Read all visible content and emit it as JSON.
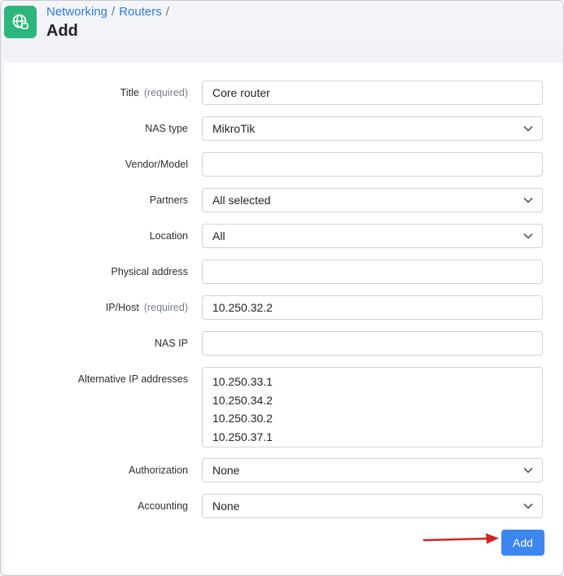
{
  "breadcrumb": {
    "items": [
      "Networking",
      "Routers"
    ],
    "separator": "/"
  },
  "page": {
    "title": "Add"
  },
  "icons": {
    "app": "globe-router-icon",
    "select_caret": "chevron-down-icon"
  },
  "colors": {
    "app_icon_bg": "#2db67c",
    "link": "#2f7bd8",
    "primary_button": "#3c86f0",
    "annotation_arrow": "#d42424"
  },
  "form": {
    "required_marker": "(required)",
    "fields": {
      "title": {
        "label": "Title",
        "value": "Core router",
        "required": true
      },
      "nas_type": {
        "label": "NAS type",
        "value": "MikroTik"
      },
      "vendor_model": {
        "label": "Vendor/Model",
        "value": ""
      },
      "partners": {
        "label": "Partners",
        "value": "All selected"
      },
      "location": {
        "label": "Location",
        "value": "All"
      },
      "physical_address": {
        "label": "Physical address",
        "value": ""
      },
      "ip_host": {
        "label": "IP/Host",
        "value": "10.250.32.2",
        "required": true
      },
      "nas_ip": {
        "label": "NAS IP",
        "value": ""
      },
      "alternative_ips": {
        "label": "Alternative IP addresses",
        "values": [
          "10.250.33.1",
          "10.250.34.2",
          "10.250.30.2",
          "10.250.37.1"
        ]
      },
      "authorization": {
        "label": "Authorization",
        "value": "None"
      },
      "accounting": {
        "label": "Accounting",
        "value": "None"
      }
    },
    "submit_label": "Add"
  }
}
